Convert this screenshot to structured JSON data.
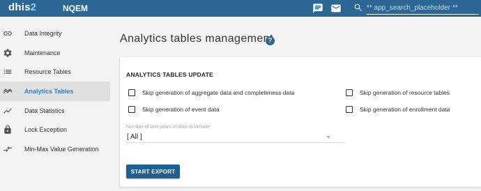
{
  "header": {
    "logo_main": "dhis",
    "logo_accent": "2",
    "instance_name": "NQEM",
    "search_placeholder": "** app_search_placeholder **",
    "icons": [
      "chat-icon",
      "mail-icon",
      "search-icon"
    ],
    "color": "#2c6693"
  },
  "sidebar": {
    "items": [
      {
        "label": "Data Integrity",
        "icon": "link-icon",
        "active": false
      },
      {
        "label": "Maintenance",
        "icon": "gear-icon",
        "active": false
      },
      {
        "label": "Resource Tables",
        "icon": "list-icon",
        "active": false
      },
      {
        "label": "Analytics Tables",
        "icon": "trending-icon",
        "active": true
      },
      {
        "label": "Data Statistics",
        "icon": "trending-up-icon",
        "active": false
      },
      {
        "label": "Lock Exception",
        "icon": "lock-icon",
        "active": false
      },
      {
        "label": "Min-Max Value Generation",
        "icon": "compare-arrows-icon",
        "active": false
      }
    ],
    "active_color": "#1e88e5"
  },
  "main": {
    "title": "Analytics tables management",
    "help_icon_glyph": "?",
    "card": {
      "title": "ANALYTICS TABLES UPDATE",
      "checkboxes": [
        {
          "label": "Skip generation of aggregate data and completeness data",
          "checked": false
        },
        {
          "label": "Skip generation of event data",
          "checked": false
        },
        {
          "label": "Skip generation of resource tables",
          "checked": false
        },
        {
          "label": "Skip generation of enrollment data",
          "checked": false
        }
      ],
      "years_select": {
        "label": "Number of last years of data to include",
        "value": "[ All ]"
      },
      "start_button": "START EXPORT"
    }
  }
}
